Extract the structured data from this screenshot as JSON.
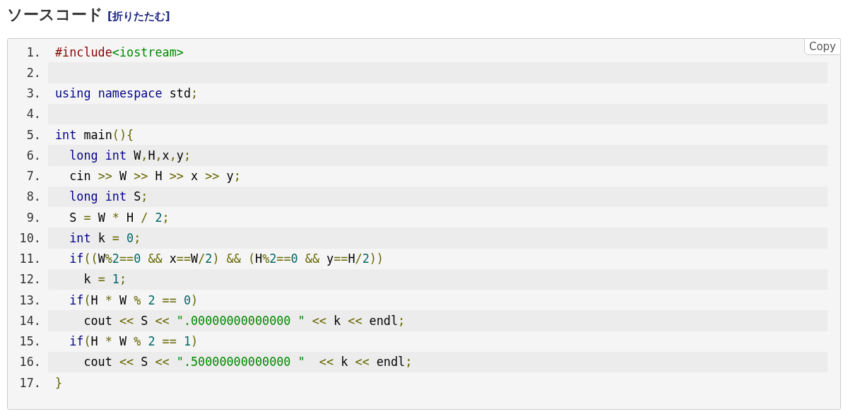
{
  "heading": {
    "title": "ソースコード",
    "toggle_link": "[折りたたむ]"
  },
  "code_block": {
    "copy_button": "Copy",
    "lines": [
      {
        "number": "1.",
        "tokens": [
          {
            "kind": "dir",
            "text": "#include"
          },
          {
            "kind": "str",
            "text": "<iostream>"
          }
        ]
      },
      {
        "number": "2."
      },
      {
        "number": "3.",
        "tokens": [
          {
            "kind": "kwd",
            "text": "using"
          },
          {
            "kind": "kwd",
            "text": " namespace"
          },
          {
            "kind": "pln",
            "text": " std"
          },
          {
            "kind": "pun",
            "text": ";"
          }
        ]
      },
      {
        "number": "4."
      },
      {
        "number": "5.",
        "tokens": [
          {
            "kind": "kwd",
            "text": "int"
          },
          {
            "kind": "pln",
            "text": " main"
          },
          {
            "kind": "pun",
            "text": "(){"
          }
        ]
      },
      {
        "number": "6.",
        "tokens": [
          {
            "kind": "kwd",
            "text": "  long"
          },
          {
            "kind": "kwd",
            "text": " int"
          },
          {
            "kind": "pln",
            "text": " W"
          },
          {
            "kind": "pun",
            "text": ","
          },
          {
            "kind": "pln",
            "text": "H"
          },
          {
            "kind": "pun",
            "text": ","
          },
          {
            "kind": "pln",
            "text": "x"
          },
          {
            "kind": "pun",
            "text": ","
          },
          {
            "kind": "pln",
            "text": "y"
          },
          {
            "kind": "pun",
            "text": ";"
          }
        ]
      },
      {
        "number": "7.",
        "tokens": [
          {
            "kind": "pln",
            "text": "  cin "
          },
          {
            "kind": "pun",
            "text": ">>"
          },
          {
            "kind": "pln",
            "text": " W "
          },
          {
            "kind": "pun",
            "text": ">>"
          },
          {
            "kind": "pln",
            "text": " H "
          },
          {
            "kind": "pun",
            "text": ">>"
          },
          {
            "kind": "pln",
            "text": " x "
          },
          {
            "kind": "pun",
            "text": ">>"
          },
          {
            "kind": "pln",
            "text": " y"
          },
          {
            "kind": "pun",
            "text": ";"
          }
        ]
      },
      {
        "number": "8.",
        "tokens": [
          {
            "kind": "kwd",
            "text": "  long"
          },
          {
            "kind": "kwd",
            "text": " int"
          },
          {
            "kind": "pln",
            "text": " S"
          },
          {
            "kind": "pun",
            "text": ";"
          }
        ]
      },
      {
        "number": "9.",
        "tokens": [
          {
            "kind": "pln",
            "text": "  S "
          },
          {
            "kind": "pun",
            "text": "="
          },
          {
            "kind": "pln",
            "text": " W "
          },
          {
            "kind": "pun",
            "text": "*"
          },
          {
            "kind": "pln",
            "text": " H "
          },
          {
            "kind": "pun",
            "text": "/"
          },
          {
            "kind": "lit",
            "text": " 2"
          },
          {
            "kind": "pun",
            "text": ";"
          }
        ]
      },
      {
        "number": "10.",
        "tokens": [
          {
            "kind": "kwd",
            "text": "  int"
          },
          {
            "kind": "pln",
            "text": " k "
          },
          {
            "kind": "pun",
            "text": "="
          },
          {
            "kind": "lit",
            "text": " 0"
          },
          {
            "kind": "pun",
            "text": ";"
          }
        ]
      },
      {
        "number": "11.",
        "tokens": [
          {
            "kind": "kwd",
            "text": "  if"
          },
          {
            "kind": "pun",
            "text": "(("
          },
          {
            "kind": "pln",
            "text": "W"
          },
          {
            "kind": "pun",
            "text": "%"
          },
          {
            "kind": "lit",
            "text": "2"
          },
          {
            "kind": "pun",
            "text": "=="
          },
          {
            "kind": "lit",
            "text": "0"
          },
          {
            "kind": "pun",
            "text": " &&"
          },
          {
            "kind": "pln",
            "text": " x"
          },
          {
            "kind": "pun",
            "text": "=="
          },
          {
            "kind": "pln",
            "text": "W"
          },
          {
            "kind": "pun",
            "text": "/"
          },
          {
            "kind": "lit",
            "text": "2"
          },
          {
            "kind": "pun",
            "text": ")"
          },
          {
            "kind": "pun",
            "text": " &&"
          },
          {
            "kind": "pun",
            "text": " ("
          },
          {
            "kind": "pln",
            "text": "H"
          },
          {
            "kind": "pun",
            "text": "%"
          },
          {
            "kind": "lit",
            "text": "2"
          },
          {
            "kind": "pun",
            "text": "=="
          },
          {
            "kind": "lit",
            "text": "0"
          },
          {
            "kind": "pun",
            "text": " &&"
          },
          {
            "kind": "pln",
            "text": " y"
          },
          {
            "kind": "pun",
            "text": "=="
          },
          {
            "kind": "pln",
            "text": "H"
          },
          {
            "kind": "pun",
            "text": "/"
          },
          {
            "kind": "lit",
            "text": "2"
          },
          {
            "kind": "pun",
            "text": "))"
          }
        ]
      },
      {
        "number": "12.",
        "tokens": [
          {
            "kind": "pln",
            "text": "    k "
          },
          {
            "kind": "pun",
            "text": "="
          },
          {
            "kind": "lit",
            "text": " 1"
          },
          {
            "kind": "pun",
            "text": ";"
          }
        ]
      },
      {
        "number": "13.",
        "tokens": [
          {
            "kind": "kwd",
            "text": "  if"
          },
          {
            "kind": "pun",
            "text": "("
          },
          {
            "kind": "pln",
            "text": "H "
          },
          {
            "kind": "pun",
            "text": "*"
          },
          {
            "kind": "pln",
            "text": " W "
          },
          {
            "kind": "pun",
            "text": "%"
          },
          {
            "kind": "lit",
            "text": " 2"
          },
          {
            "kind": "pun",
            "text": " =="
          },
          {
            "kind": "lit",
            "text": " 0"
          },
          {
            "kind": "pun",
            "text": ")"
          }
        ]
      },
      {
        "number": "14.",
        "tokens": [
          {
            "kind": "pln",
            "text": "    cout "
          },
          {
            "kind": "pun",
            "text": "<<"
          },
          {
            "kind": "pln",
            "text": " S "
          },
          {
            "kind": "pun",
            "text": "<<"
          },
          {
            "kind": "str",
            "text": " \".00000000000000 \""
          },
          {
            "kind": "pun",
            "text": " <<"
          },
          {
            "kind": "pln",
            "text": " k "
          },
          {
            "kind": "pun",
            "text": "<<"
          },
          {
            "kind": "pln",
            "text": " endl"
          },
          {
            "kind": "pun",
            "text": ";"
          }
        ]
      },
      {
        "number": "15.",
        "tokens": [
          {
            "kind": "kwd",
            "text": "  if"
          },
          {
            "kind": "pun",
            "text": "("
          },
          {
            "kind": "pln",
            "text": "H "
          },
          {
            "kind": "pun",
            "text": "*"
          },
          {
            "kind": "pln",
            "text": " W "
          },
          {
            "kind": "pun",
            "text": "%"
          },
          {
            "kind": "lit",
            "text": " 2"
          },
          {
            "kind": "pun",
            "text": " =="
          },
          {
            "kind": "lit",
            "text": " 1"
          },
          {
            "kind": "pun",
            "text": ")"
          }
        ]
      },
      {
        "number": "16.",
        "tokens": [
          {
            "kind": "pln",
            "text": "    cout "
          },
          {
            "kind": "pun",
            "text": "<<"
          },
          {
            "kind": "pln",
            "text": " S "
          },
          {
            "kind": "pun",
            "text": "<<"
          },
          {
            "kind": "str",
            "text": " \".50000000000000 \""
          },
          {
            "kind": "pun",
            "text": "  <<"
          },
          {
            "kind": "pln",
            "text": " k "
          },
          {
            "kind": "pun",
            "text": "<<"
          },
          {
            "kind": "pln",
            "text": " endl"
          },
          {
            "kind": "pun",
            "text": ";"
          }
        ]
      },
      {
        "number": "17.",
        "tokens": [
          {
            "kind": "pun",
            "text": "}"
          }
        ]
      }
    ]
  }
}
